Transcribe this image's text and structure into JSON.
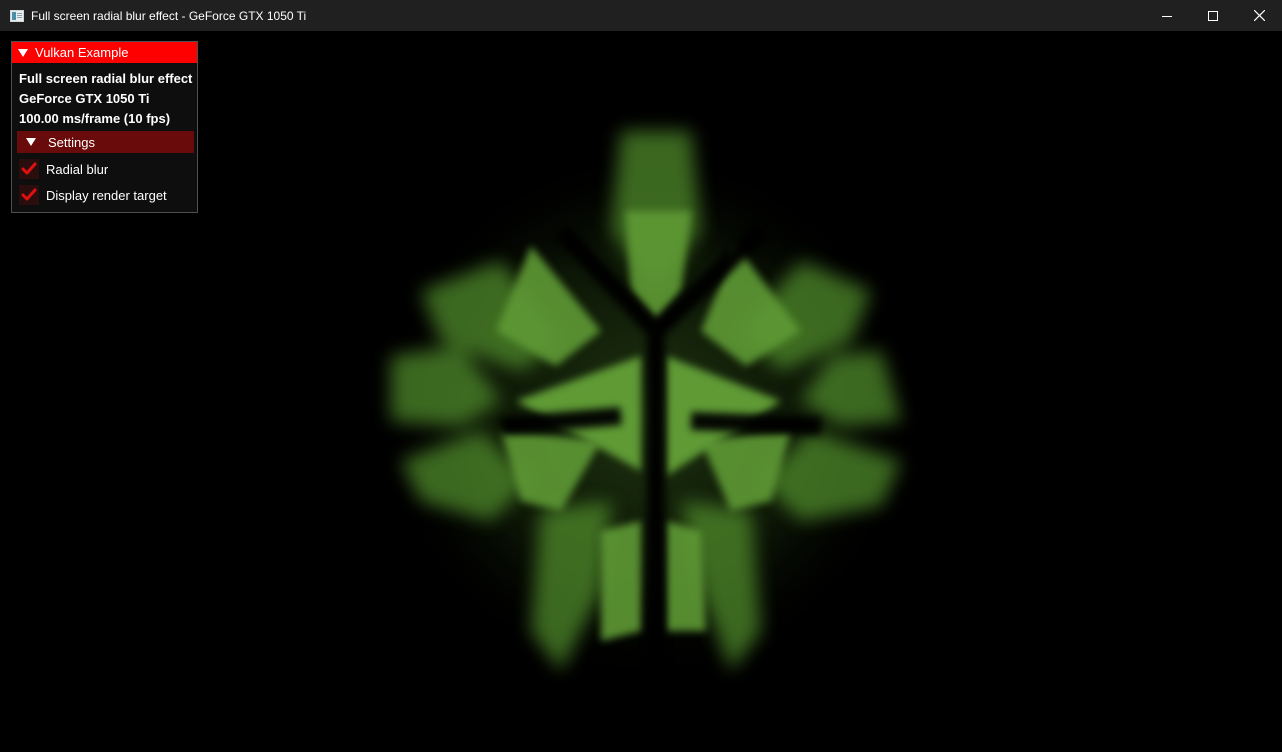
{
  "window": {
    "title": "Full screen radial blur effect - GeForce GTX 1050 Ti",
    "controls": {
      "minimize_icon": "minimize-icon",
      "maximize_icon": "maximize-icon",
      "close_icon": "close-icon"
    }
  },
  "overlay": {
    "header": "Vulkan Example",
    "lines": [
      "Full screen radial blur effect",
      "GeForce GTX 1050 Ti",
      "100.00 ms/frame (10 fps)"
    ],
    "settings_label": "Settings",
    "checkboxes": [
      {
        "label": "Radial blur",
        "checked": true
      },
      {
        "label": "Display render target",
        "checked": true
      }
    ]
  },
  "colors": {
    "header_red": "#ff0000",
    "settings_bg": "#6a0b0b",
    "check_red": "#e01010",
    "glow_green": "#5e9a35"
  }
}
